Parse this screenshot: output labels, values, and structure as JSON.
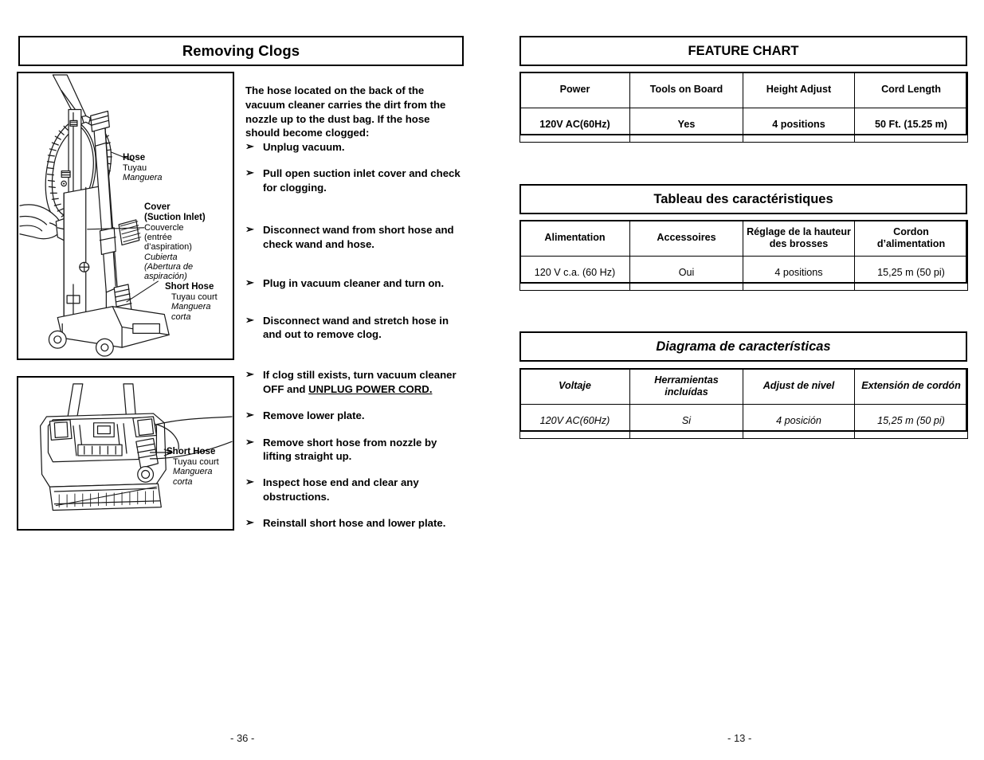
{
  "left_page": {
    "section_title": "Removing Clogs",
    "page_number": "- 36 -",
    "intro_paragraph": "The hose located on the back of the vacuum cleaner carries the dirt from the nozzle up to the dust bag.  If the hose should become clogged:",
    "bullet_glyph": "➢",
    "steps": [
      {
        "text": "Unplug vacuum."
      },
      {
        "text": "Pull open suction inlet cover and check for clogging."
      },
      {
        "text": "Disconnect wand from short hose and check wand and hose."
      },
      {
        "text": "Plug in vacuum cleaner and turn on."
      },
      {
        "text": "Disconnect wand and stretch hose in and out to remove clog."
      },
      {
        "text_before": "If clog still exists, turn vacuum cleaner OFF and ",
        "underlined": "UNPLUG POWER CORD.",
        "text": "If clog still exists, turn vacuum cleaner OFF and UNPLUG POWER CORD."
      },
      {
        "text": "Remove lower plate."
      },
      {
        "text": "Remove short hose from nozzle by lifting straight up."
      },
      {
        "text": "Inspect hose end and clear any obstructions."
      },
      {
        "text": "Reinstall short hose and lower plate."
      }
    ],
    "figure_upright": {
      "name": "upright-vacuum-rear-view",
      "callouts": [
        {
          "en": "Hose",
          "fr": "Tuyau",
          "es": "Manguera"
        },
        {
          "en": "Cover",
          "en2": "(Suction Inlet)",
          "fr": "Couvercle",
          "fr2": "(entrée",
          "fr3": "d’aspiration)",
          "es": "Cubierta",
          "es2": "(Abertura de",
          "es3": "aspiración)"
        },
        {
          "en": "Short Hose",
          "fr": "Tuyau court",
          "es": "Manguera",
          "es2": "corta"
        }
      ]
    },
    "figure_nozzle": {
      "name": "nozzle-underside-view",
      "callouts": [
        {
          "en": "Short Hose",
          "fr": "Tuyau court",
          "es": "Manguera",
          "es2": "corta"
        }
      ]
    }
  },
  "right_page": {
    "page_number": "- 13 -",
    "charts": [
      {
        "id": "feature-chart-en",
        "title": "FEATURE CHART",
        "lang": "en",
        "headers": [
          "Power",
          "Tools on Board",
          "Height Adjust",
          "Cord Length"
        ],
        "values": [
          "120V AC(60Hz)",
          "Yes",
          "4 positions",
          "50 Ft. (15.25 m)"
        ]
      },
      {
        "id": "feature-chart-fr",
        "title": "Tableau des caractéristiques",
        "lang": "fr",
        "headers": [
          "Alimentation",
          "Accessoires",
          "Réglage de la hauteur des brosses",
          "Cordon d’alimentation"
        ],
        "values": [
          "120 V c.a. (60 Hz)",
          "Oui",
          "4 positions",
          "15,25 m (50 pi)"
        ]
      },
      {
        "id": "feature-chart-es",
        "title": "Diagrama de características",
        "lang": "es",
        "headers": [
          "Voltaje",
          "Herramientas incluídas",
          "Adjust de nivel",
          "Extensión de cordón"
        ],
        "values": [
          "120V AC(60Hz)",
          "Si",
          "4 posición",
          "15,25 m (50 pi)"
        ]
      }
    ]
  }
}
